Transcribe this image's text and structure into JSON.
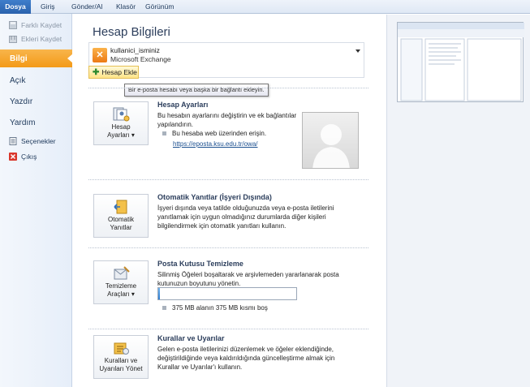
{
  "tabs": [
    "Dosya",
    "Giriş",
    "Gönder/Al",
    "Klasör",
    "Görünüm"
  ],
  "nav": {
    "top": [
      "Farklı Kaydet",
      "Ekleri Kaydet"
    ],
    "main": [
      "Bilgi",
      "Açık",
      "Yazdır",
      "Yardım"
    ],
    "bottom": [
      "Seçenekler",
      "Çıkış"
    ],
    "active": "Bilgi"
  },
  "page": {
    "title": "Hesap Bilgileri",
    "account_name": "kullanici_isminiz",
    "account_type": "Microsoft Exchange",
    "add_account_label": "Hesap Ekle",
    "add_account_tooltip": "Bir e-posta hesabı veya başka bir bağlantı ekleyin."
  },
  "sections": {
    "account_settings": {
      "button_line1": "Hesap",
      "button_line2": "Ayarları ▾",
      "title": "Hesap Ayarları",
      "text_line1": "Bu hesabın ayarlarını değiştirin ve ek bağlantılar",
      "text_line2": "yapılandırın.",
      "bullet": "Bu hesaba web üzerinden erişin.",
      "link": "https://eposta.ksu.edu.tr/owa/"
    },
    "auto_replies": {
      "button_line1": "Otomatik",
      "button_line2": "Yanıtlar",
      "title": "Otomatik Yanıtlar (İşyeri Dışında)",
      "text_line1": "İşyeri dışında veya tatilde olduğunuzda veya e-posta iletilerini",
      "text_line2": "yanıtlamak için uygun olmadığınız durumlarda diğer kişileri",
      "text_line3": "bilgilendirmek için otomatik yanıtları kullanın."
    },
    "cleanup": {
      "button_line1": "Temizleme",
      "button_line2": "Araçları ▾",
      "title": "Posta Kutusu Temizleme",
      "text_line1": "Silinmiş Öğeleri boşaltarak ve arşivlemeden yararlanarak posta",
      "text_line2": "kutunuzun boyutunu yönetin.",
      "usage_text": "375 MB alanın 375 MB kısmı boş",
      "usage_fraction": 0.01
    },
    "rules": {
      "button_line1": "Kuralları ve",
      "button_line2": "Uyarıları Yönet",
      "title": "Kurallar ve Uyarılar",
      "text_line1": "Gelen e-posta iletilerinizi düzenlemek ve öğeler eklendiğinde,",
      "text_line2": "değiştirildiğinde veya kaldırıldığında güncelleştirme almak için",
      "text_line3": "Kurallar ve Uyarılar'ı kullanın."
    }
  },
  "colors": {
    "accent": "#2a62ad",
    "nav_active": "#f39a18",
    "link": "#1b4f8f"
  }
}
